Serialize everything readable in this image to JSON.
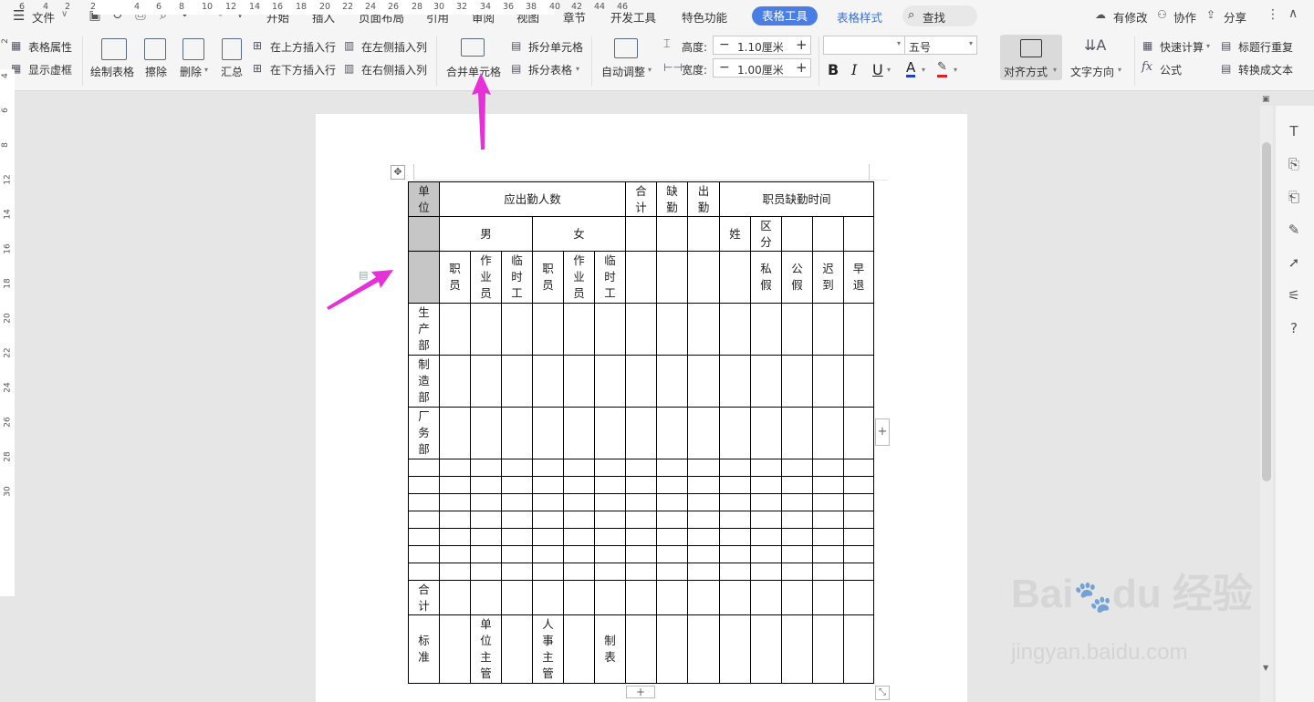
{
  "menubar": {
    "file_label": "文件",
    "tabs": [
      "开始",
      "插入",
      "页面布局",
      "引用",
      "审阅",
      "视图",
      "章节",
      "开发工具",
      "特色功能",
      "表格工具",
      "表格样式"
    ],
    "active_tab": "表格工具",
    "search_label": "查找",
    "right": {
      "modified": "有修改",
      "collab": "协作",
      "share": "分享"
    }
  },
  "ribbon": {
    "table_props": "表格属性",
    "show_grid": "显示虚框",
    "draw_table": "绘制表格",
    "erase": "擦除",
    "delete": "删除",
    "summary": "汇总",
    "insert_above": "在上方插入行",
    "insert_below": "在下方插入行",
    "insert_left": "在左侧插入列",
    "insert_right": "在右侧插入列",
    "merge_cells": "合并单元格",
    "split_cells": "拆分单元格",
    "split_table": "拆分表格",
    "auto_fit": "自动调整",
    "height_label": "高度:",
    "height_value": "1.10厘米",
    "width_label": "宽度:",
    "width_value": "1.00厘米",
    "font_name": "",
    "font_size": "五号",
    "bold": "B",
    "italic": "I",
    "underline": "U",
    "font_color": "A",
    "align": "对齐方式",
    "text_dir": "文字方向",
    "quick_calc": "快速计算",
    "repeat_header": "标题行重复",
    "formula": "公式",
    "to_text": "转换成文本"
  },
  "hruler": [
    "6",
    "4",
    "2",
    "2",
    "4",
    "6",
    "8",
    "10",
    "12",
    "14",
    "16",
    "18",
    "20",
    "22",
    "24",
    "26",
    "28",
    "30",
    "32",
    "34",
    "36",
    "38",
    "40",
    "42",
    "44",
    "46"
  ],
  "vruler": [
    "2",
    "4",
    "6",
    "8",
    "12",
    "14",
    "16",
    "18",
    "20",
    "22",
    "24",
    "26",
    "28",
    "30"
  ],
  "table": {
    "row1": {
      "unit": "单位",
      "should_attend": "应出勤人数",
      "total": "合计",
      "absent": "缺勤",
      "present": "出勤",
      "absence_time": "职员缺勤时间"
    },
    "row2": {
      "male": "男",
      "female": "女",
      "surname": "姓",
      "category": "区分"
    },
    "row3": {
      "staff_m": "职员",
      "worker_m": "作业员",
      "temp_m": "临时工",
      "staff_f": "职员",
      "worker_f": "作业员",
      "temp_f": "临时工",
      "personal_leave": "私假",
      "public_leave": "公假",
      "late": "迟到",
      "early": "早退"
    },
    "departments": [
      "生产部",
      "制造部",
      "厂务部"
    ],
    "total_row": "合计",
    "footer": {
      "standard": "标准",
      "unit_manager": "单位主管",
      "hr_manager": "人事主管",
      "prepared_by": "制表"
    }
  },
  "colors": {
    "accent": "#4a7ee7",
    "arrow": "#e630d8",
    "selected_cell": "#c6c6c6"
  }
}
